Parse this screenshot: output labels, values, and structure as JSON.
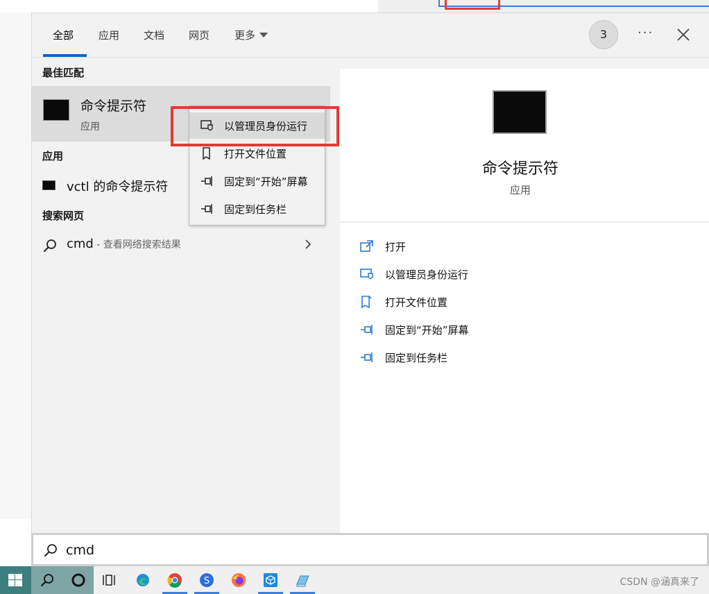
{
  "tabs": [
    {
      "label": "全部",
      "active": true
    },
    {
      "label": "应用"
    },
    {
      "label": "文档"
    },
    {
      "label": "网页"
    },
    {
      "label": "更多"
    }
  ],
  "header": {
    "badge_count": "3",
    "more_options": "···"
  },
  "best_match": {
    "section_title": "最佳匹配",
    "name": "命令提示符",
    "type": "应用"
  },
  "apps": {
    "section_title": "应用",
    "items": [
      {
        "label": "vctl 的命令提示符"
      }
    ]
  },
  "web": {
    "section_title": "搜索网页",
    "query": "cmd",
    "hint": " - 查看网络搜索结果"
  },
  "context_menu": {
    "items": [
      {
        "label": "以管理员身份运行",
        "icon": "admin-shield-icon"
      },
      {
        "label": "打开文件位置",
        "icon": "file-location-icon"
      },
      {
        "label": "固定到“开始”屏幕",
        "icon": "pin-icon"
      },
      {
        "label": "固定到任务栏",
        "icon": "pin-icon"
      }
    ]
  },
  "detail": {
    "title": "命令提示符",
    "subtitle": "应用",
    "actions": [
      {
        "label": "打开",
        "icon": "open-icon"
      },
      {
        "label": "以管理员身份运行",
        "icon": "admin-shield-icon"
      },
      {
        "label": "打开文件位置",
        "icon": "file-location-icon"
      },
      {
        "label": "固定到“开始”屏幕",
        "icon": "pin-icon"
      },
      {
        "label": "固定到任务栏",
        "icon": "pin-icon"
      }
    ]
  },
  "search": {
    "value": "cmd"
  },
  "taskbar": {
    "apps": [
      "task-view",
      "edge",
      "chrome",
      "sogou",
      "firefox",
      "app-cube",
      "app-notepad"
    ],
    "watermark": "CSDN @涵真来了"
  },
  "colors": {
    "accent": "#0a64c8",
    "highlight_red": "#e53935",
    "icon_blue": "#2b79d6"
  }
}
